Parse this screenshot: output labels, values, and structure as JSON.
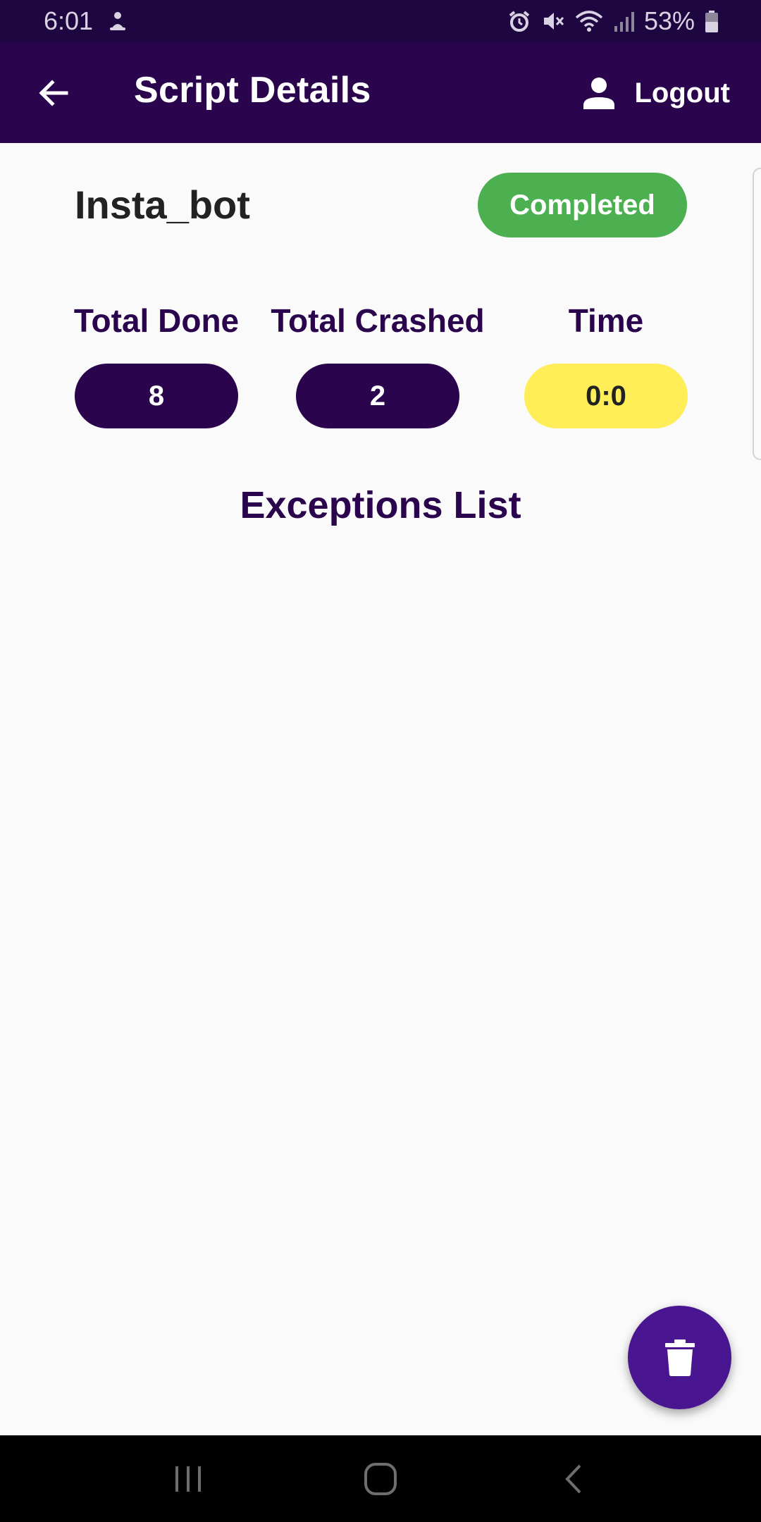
{
  "status_bar": {
    "time": "6:01",
    "battery": "53%",
    "icons": [
      "notification-icon",
      "alarm-icon",
      "mute-icon",
      "wifi-icon",
      "signal-icon",
      "battery-icon"
    ]
  },
  "app_bar": {
    "title": "Script Details",
    "logout_label": "Logout",
    "icons": [
      "back-arrow-icon",
      "person-icon"
    ]
  },
  "script": {
    "name": "Insta_bot",
    "status": "Completed"
  },
  "stats": {
    "total_done_label": "Total Done",
    "total_done_value": "8",
    "total_crashed_label": "Total Crashed",
    "total_crashed_value": "2",
    "time_label": "Time",
    "time_value": "0:0"
  },
  "exceptions": {
    "title": "Exceptions List",
    "items": []
  },
  "fab": {
    "icon": "trash-icon"
  },
  "nav_bar": {
    "icons": [
      "recents-icon",
      "home-icon",
      "back-icon"
    ]
  },
  "colors": {
    "primary": "#2a044c",
    "status_bar": "#1e0640",
    "completed": "#4caf50",
    "time_pill": "#ffee58",
    "fab": "#4a1590"
  }
}
